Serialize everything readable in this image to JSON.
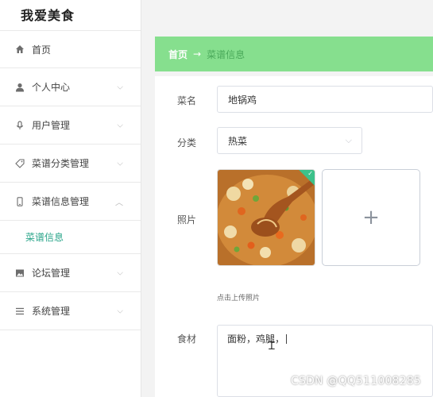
{
  "app": {
    "title": "我爱美食"
  },
  "sidebar": {
    "items": [
      {
        "label": "首页",
        "icon": "home-icon"
      },
      {
        "label": "个人中心",
        "icon": "user-icon"
      },
      {
        "label": "用户管理",
        "icon": "microphone-icon"
      },
      {
        "label": "菜谱分类管理",
        "icon": "tag-icon"
      },
      {
        "label": "菜谱信息管理",
        "icon": "phone-icon"
      },
      {
        "label": "菜谱信息",
        "icon": ""
      },
      {
        "label": "论坛管理",
        "icon": "picture-icon"
      },
      {
        "label": "系统管理",
        "icon": "list-icon"
      }
    ]
  },
  "breadcrumb": {
    "home": "首页",
    "separator": "→",
    "current": "菜谱信息"
  },
  "form": {
    "name_label": "菜名",
    "name_value": "地锅鸡",
    "category_label": "分类",
    "category_value": "热菜",
    "photo_label": "照片",
    "upload_plus": "+",
    "upload_tip": "点击上传照片",
    "ingredients_label": "食材",
    "ingredients_value": "面粉，鸡腿，"
  },
  "watermark": "CSDN @QQ511008285",
  "colors": {
    "accent": "#86df8e",
    "active_sub": "#2aa58a",
    "check": "#3cc18a"
  }
}
